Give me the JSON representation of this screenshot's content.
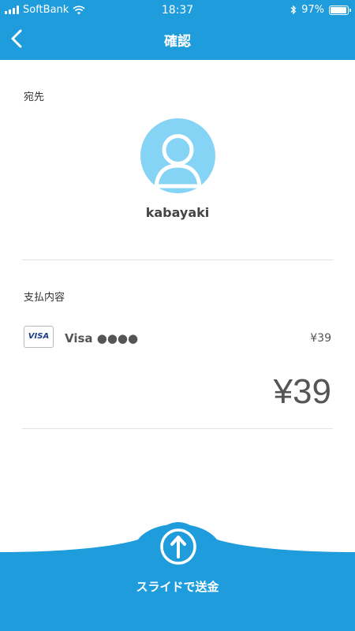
{
  "status_bar": {
    "carrier": "SoftBank",
    "time": "18:37",
    "battery": "97%"
  },
  "nav": {
    "title": "確認"
  },
  "recipient": {
    "section_label": "宛先",
    "name": "kabayaki"
  },
  "payment": {
    "section_label": "支払内容",
    "card_brand_logo": "VISA",
    "card_label": "Visa ●●●●",
    "card_amount": "¥39",
    "total": "¥39"
  },
  "action": {
    "slide_label": "スライドで送金"
  },
  "colors": {
    "primary": "#1e9cdc",
    "avatar_bg": "#86d4f5"
  }
}
